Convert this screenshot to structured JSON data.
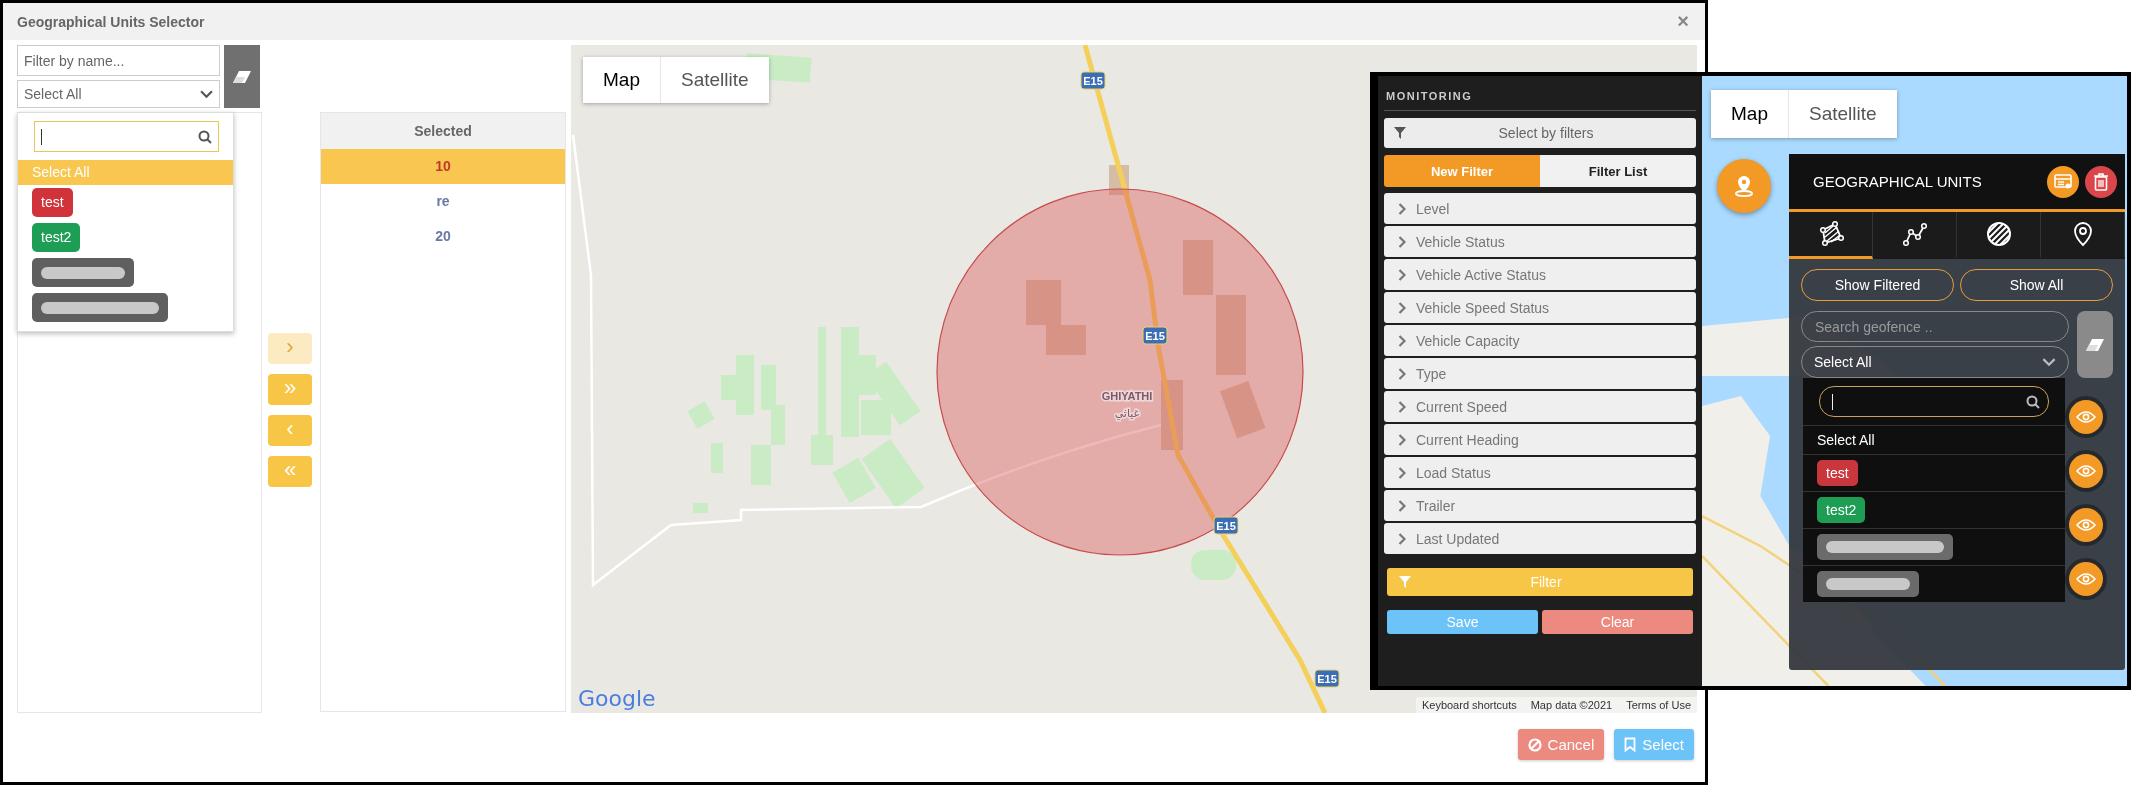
{
  "dialog": {
    "title": "Geographical Units Selector",
    "close": "×"
  },
  "name_filter": {
    "placeholder": "Filter by name..."
  },
  "group_select": {
    "value": "Select All"
  },
  "group_dropdown": [
    {
      "kind": "option",
      "label": "Select All",
      "selected": true
    },
    {
      "kind": "tag",
      "label": "test",
      "color": "#d0343a",
      "selected": false
    },
    {
      "kind": "tag",
      "label": "test2",
      "color": "#1e9e55",
      "selected": false
    },
    {
      "kind": "redacted",
      "color": "#5f5f5f",
      "selected": false
    },
    {
      "kind": "redacted",
      "color": "#5f5f5f",
      "selected": false
    }
  ],
  "transfer_buttons": [
    {
      "symbol": "›",
      "disabled": true
    },
    {
      "symbol": "»",
      "disabled": false
    },
    {
      "symbol": "‹",
      "disabled": false
    },
    {
      "symbol": "«",
      "disabled": false
    }
  ],
  "selected_list": {
    "header": "Selected",
    "rows": [
      {
        "label": "10",
        "selected": true
      },
      {
        "label": "re",
        "selected": false
      },
      {
        "label": "20",
        "selected": false
      }
    ]
  },
  "map": {
    "map_types": [
      {
        "label": "Map",
        "selected": true
      },
      {
        "label": "Satellite",
        "selected": false
      }
    ],
    "place_name": "GHIYATHI",
    "place_name_arabic": "غياثي",
    "road_shields": [
      "E15",
      "E15",
      "E15",
      "E15"
    ],
    "logo": "Google",
    "attribution": [
      "Keyboard shortcuts",
      "Map data ©2021",
      "Terms of Use"
    ]
  },
  "footer_buttons": [
    {
      "kind": "cancel",
      "label": "Cancel"
    },
    {
      "kind": "select",
      "label": "Select"
    }
  ],
  "inset": {
    "monitoring": {
      "title": "MONITORING",
      "filter_mode": "Select by filters",
      "tabs": [
        {
          "label": "New Filter",
          "selected": true
        },
        {
          "label": "Filter List",
          "selected": false
        }
      ],
      "filters": [
        "Level",
        "Vehicle Status",
        "Vehicle Active Status",
        "Vehicle Speed Status",
        "Vehicle Capacity",
        "Type",
        "Current Speed",
        "Current Heading",
        "Load Status",
        "Trailer",
        "Last Updated"
      ],
      "filter_button": "Filter",
      "actions": [
        {
          "kind": "save",
          "label": "Save"
        },
        {
          "kind": "clear",
          "label": "Clear"
        }
      ]
    },
    "map_types": [
      {
        "label": "Map",
        "selected": true
      },
      {
        "label": "Satellite",
        "selected": false
      }
    ],
    "geo_panel": {
      "title": "GEOGRAPHICAL UNITS",
      "tabs": [
        {
          "kind": "polygon",
          "selected": true
        },
        {
          "kind": "polyline",
          "selected": false
        },
        {
          "kind": "circle",
          "selected": false
        },
        {
          "kind": "marker",
          "selected": false
        }
      ],
      "view_buttons": [
        "Show Filtered",
        "Show All"
      ],
      "search": {
        "placeholder": "Search geofence .."
      },
      "select": {
        "value": "Select All"
      },
      "dropdown": [
        {
          "kind": "option",
          "label": "Select All"
        },
        {
          "kind": "tag",
          "label": "test",
          "color": "#c9363b"
        },
        {
          "kind": "tag",
          "label": "test2",
          "color": "#1e9e55"
        },
        {
          "kind": "redacted",
          "color": "#6b6b6b"
        },
        {
          "kind": "redacted",
          "color": "#6b6b6b"
        }
      ]
    }
  }
}
